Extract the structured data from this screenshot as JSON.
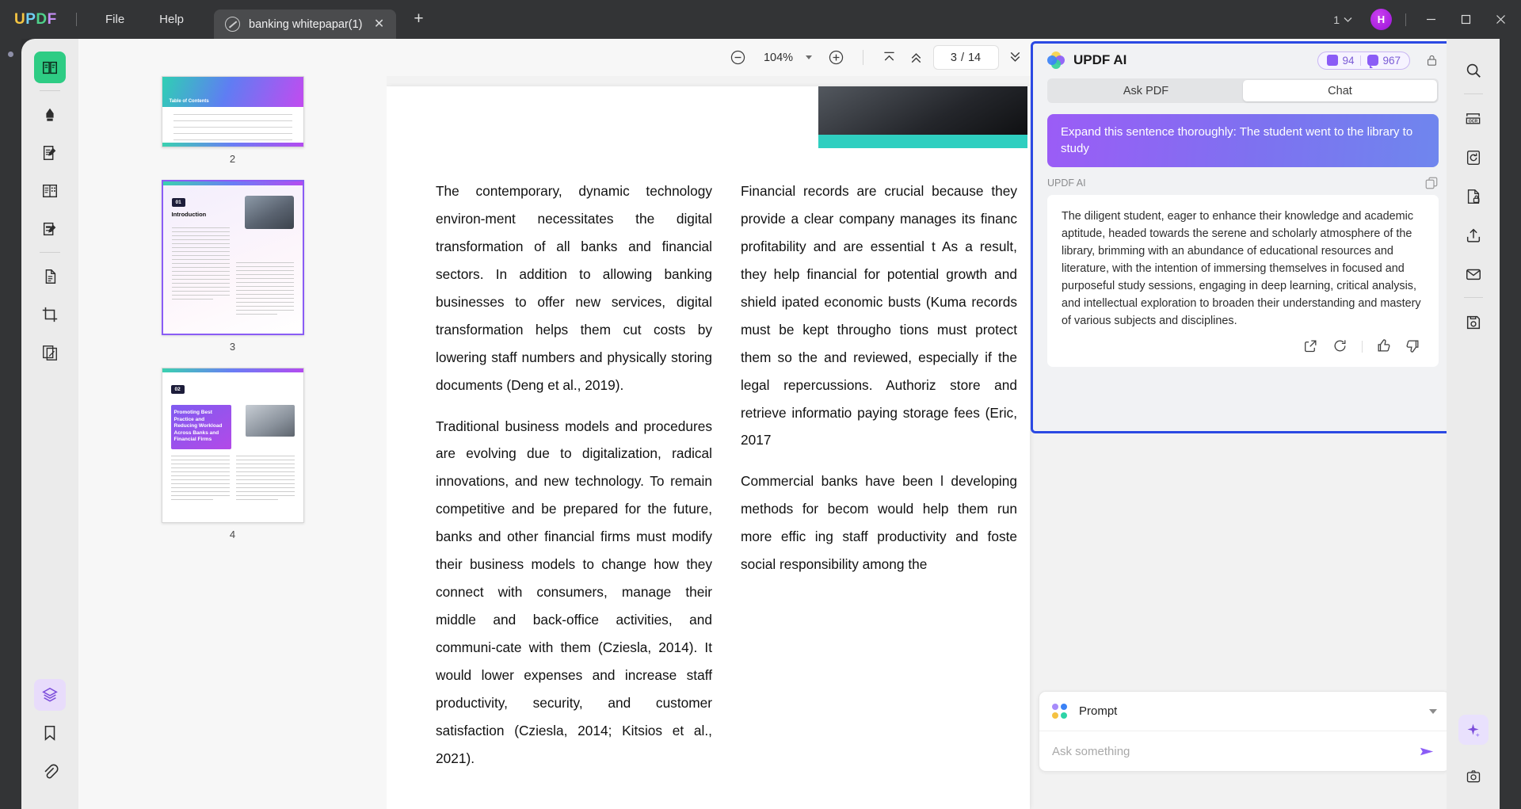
{
  "app": {
    "logo_letters": [
      "U",
      "P",
      "D",
      "F"
    ],
    "menus": [
      {
        "label": "File",
        "name": "menu-file"
      },
      {
        "label": "Help",
        "name": "menu-help"
      }
    ],
    "tab": {
      "title": "banking whitepapar(1)",
      "close": "✕"
    },
    "new_tab": "+",
    "window_count": "1",
    "avatar_initial": "H",
    "window_controls": {
      "minimize": "─",
      "maximize": "☐",
      "close": "✕"
    }
  },
  "toolbar": {
    "zoom_out": "zoom-out",
    "zoom_value": "104%",
    "zoom_in": "zoom-in",
    "first_page": "first-page",
    "prev_page": "previous-page",
    "current_page": "3",
    "page_separator": "/",
    "total_pages": "14",
    "next_page": "next-page",
    "last_page": "last-page",
    "presentation": "presentation-mode"
  },
  "thumbnails": [
    {
      "number": "2",
      "kind": "toc",
      "title": "Table of Contents",
      "selected": false
    },
    {
      "number": "3",
      "kind": "intro",
      "chip": "01",
      "heading": "Introduction",
      "selected": true
    },
    {
      "number": "4",
      "kind": "promo",
      "chip": "02",
      "heading": "Promoting Best Practice and Reducing Workload Across Banks and Financial Firms",
      "selected": false
    }
  ],
  "document": {
    "left_column": [
      "The contemporary, dynamic technology environ-ment necessitates the digital transformation of all banks and financial sectors. In addition to allowing banking businesses to offer new services, digital transformation helps them cut costs by lowering staff numbers and physically storing documents (Deng et al., 2019).",
      "Traditional business models and procedures are evolving due to digitalization, radical innovations, and new technology. To remain competitive and be prepared for the future, banks and other financial firms must modify their business models to change how they connect with consumers, manage their middle and back-office activities, and communi-cate with them (Cziesla, 2014). It would lower expenses and increase staff productivity, security, and customer satisfaction (Cziesla, 2014; Kitsios et al., 2021)."
    ],
    "right_column": [
      "Financial records are crucial because they provide a clear company manages its financ profitability and are essential t As a result, they help financial for potential growth and shield ipated economic busts (Kuma records must be kept througho tions must protect them so the and reviewed, especially if the legal repercussions. Authoriz store and retrieve informatio paying storage fees (Eric, 2017",
      "Commercial banks have been l developing methods for becom would help them run more effic ing staff productivity and foste social responsibility among the"
    ]
  },
  "ai_panel": {
    "title": "UPDF AI",
    "badge_pages": "94",
    "badge_chats": "967",
    "tabs": [
      {
        "label": "Ask PDF",
        "active": false
      },
      {
        "label": "Chat",
        "active": true
      }
    ],
    "user_prompt": "Expand this sentence thoroughly: The student went to the library to study",
    "assistant_name": "UPDF AI",
    "assistant_answer": "The diligent student, eager to enhance their knowledge and academic aptitude, headed towards the serene and scholarly atmosphere of the library, brimming with an abundance of educational resources and literature, with the intention of immersing themselves in focused and purposeful study sessions, engaging in deep learning, critical analysis, and intellectual exploration to broaden their understanding and mastery of various subjects and disciplines.",
    "actions": [
      "share-icon",
      "regenerate-icon",
      "thumbs-up-icon",
      "thumbs-down-icon"
    ],
    "accent_border": "#2b49e3",
    "bubble_gradient_from": "#9b5cf6",
    "bubble_gradient_to": "#6f86ee"
  },
  "prompt_dock": {
    "mode_label": "Prompt",
    "input_value": "",
    "input_placeholder": "Ask something",
    "send": "send-icon"
  },
  "left_tools": [
    {
      "name": "reader-view",
      "active": true
    },
    {
      "name": "highlight-comment",
      "active": false
    },
    {
      "name": "edit-pdf",
      "active": false
    },
    {
      "name": "page-organize",
      "active": false
    },
    {
      "name": "fill-sign",
      "active": false
    },
    {
      "name": "convert-pdf",
      "active": false
    },
    {
      "name": "crop-page",
      "active": false
    },
    {
      "name": "compare-files",
      "active": false
    }
  ],
  "left_bottom_tools": [
    {
      "name": "layers",
      "active": true
    },
    {
      "name": "bookmark",
      "active": false
    },
    {
      "name": "attachment",
      "active": false
    }
  ],
  "right_tools": [
    {
      "name": "search"
    },
    {
      "name": "ocr"
    },
    {
      "name": "convert"
    },
    {
      "name": "protect"
    },
    {
      "name": "share"
    },
    {
      "name": "email"
    },
    {
      "name": "save"
    }
  ],
  "right_bottom": [
    {
      "name": "ai-assistant"
    },
    {
      "name": "screenshot"
    }
  ]
}
